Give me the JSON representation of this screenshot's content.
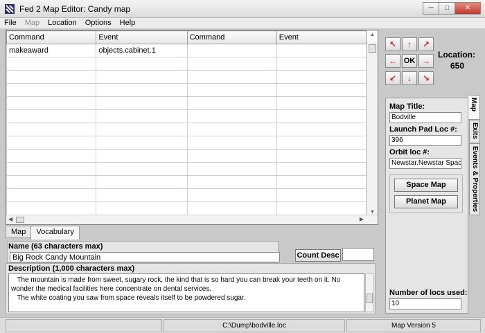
{
  "window": {
    "title": "Fed 2 Map Editor: Candy map"
  },
  "menu": [
    {
      "label": "File",
      "enabled": true
    },
    {
      "label": "Map",
      "enabled": false
    },
    {
      "label": "Location",
      "enabled": true
    },
    {
      "label": "Options",
      "enabled": true
    },
    {
      "label": "Help",
      "enabled": true
    }
  ],
  "grid": {
    "columns": [
      "Command",
      "Event",
      "Command",
      "Event"
    ],
    "rows": [
      [
        "makeaward",
        "objects.cabinet.1",
        "",
        ""
      ]
    ]
  },
  "bottom_tabs": [
    {
      "label": "Map",
      "active": false
    },
    {
      "label": "Vocabulary",
      "active": true
    }
  ],
  "name_section": {
    "label": "Name (63 characters max)",
    "value": "Big Rock Candy Mountain",
    "count_button": "Count Desc",
    "count_value": ""
  },
  "description": {
    "label": "Description (1,000 characters max)",
    "text": "   The mountain is made from sweet, sugary rock, the kind that is so hard you can break your teeth on it. No wonder the medical facilities here concentrate on dental services.\n   The white coating you saw from space reveals itself to be powdered sugar."
  },
  "nav": {
    "ok_label": "OK"
  },
  "location": {
    "label": "Location:",
    "value": "650"
  },
  "side_tabs": [
    {
      "label": "Map",
      "active": true
    },
    {
      "label": "Exits",
      "active": false
    },
    {
      "label": "Events & Properties",
      "active": false
    }
  ],
  "map_props": {
    "title_label": "Map Title:",
    "title_value": "Bodville",
    "launch_label": "Launch Pad Loc #:",
    "launch_value": "396",
    "orbit_label": "Orbit loc #:",
    "orbit_value": "Newstar.Newstar Space",
    "space_map_button": "Space Map",
    "planet_map_button": "Planet Map",
    "locs_used_label": "Number of locs used:",
    "locs_used_value": "10"
  },
  "status": {
    "path": "C:\\Dump\\bodville.loc",
    "version": "Map Version 5"
  }
}
